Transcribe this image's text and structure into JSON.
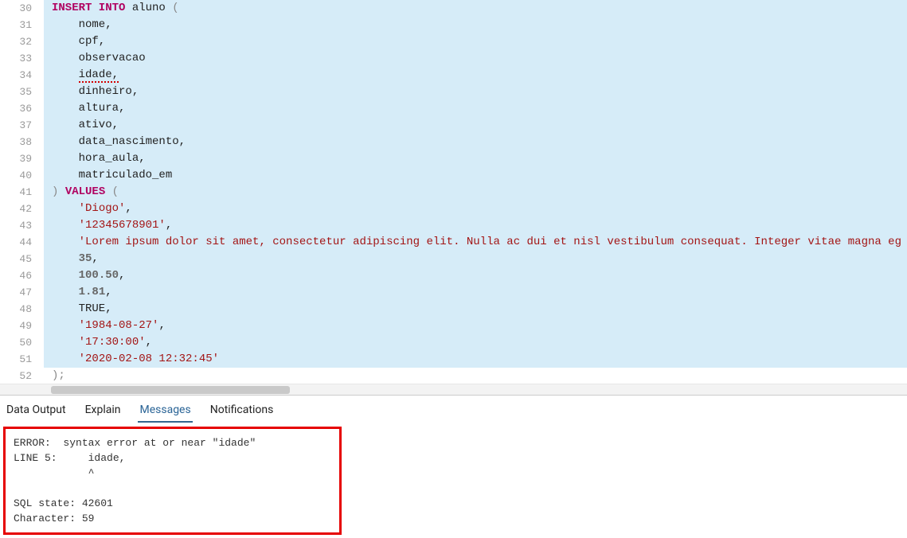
{
  "editor": {
    "lines": [
      {
        "num": 30,
        "sel": true,
        "tokens": [
          {
            "t": "kw",
            "v": "INSERT INTO"
          },
          {
            "t": "txt",
            "v": " aluno "
          },
          {
            "t": "punct",
            "v": "("
          }
        ]
      },
      {
        "num": 31,
        "sel": true,
        "tokens": [
          {
            "t": "txt",
            "v": "    nome,"
          }
        ]
      },
      {
        "num": 32,
        "sel": true,
        "tokens": [
          {
            "t": "txt",
            "v": "    cpf,"
          }
        ]
      },
      {
        "num": 33,
        "sel": true,
        "tokens": [
          {
            "t": "txt",
            "v": "    observacao"
          }
        ]
      },
      {
        "num": 34,
        "sel": true,
        "tokens": [
          {
            "t": "txt",
            "v": "    "
          },
          {
            "t": "err",
            "v": "idade,"
          }
        ]
      },
      {
        "num": 35,
        "sel": true,
        "tokens": [
          {
            "t": "txt",
            "v": "    dinheiro,"
          }
        ]
      },
      {
        "num": 36,
        "sel": true,
        "tokens": [
          {
            "t": "txt",
            "v": "    altura,"
          }
        ]
      },
      {
        "num": 37,
        "sel": true,
        "tokens": [
          {
            "t": "txt",
            "v": "    ativo,"
          }
        ]
      },
      {
        "num": 38,
        "sel": true,
        "tokens": [
          {
            "t": "txt",
            "v": "    data_nascimento,"
          }
        ]
      },
      {
        "num": 39,
        "sel": true,
        "tokens": [
          {
            "t": "txt",
            "v": "    hora_aula,"
          }
        ]
      },
      {
        "num": 40,
        "sel": true,
        "tokens": [
          {
            "t": "txt",
            "v": "    matriculado_em"
          }
        ]
      },
      {
        "num": 41,
        "sel": true,
        "tokens": [
          {
            "t": "punct",
            "v": ")"
          },
          {
            "t": "txt",
            "v": " "
          },
          {
            "t": "kw",
            "v": "VALUES"
          },
          {
            "t": "txt",
            "v": " "
          },
          {
            "t": "punct",
            "v": "("
          }
        ]
      },
      {
        "num": 42,
        "sel": true,
        "tokens": [
          {
            "t": "txt",
            "v": "    "
          },
          {
            "t": "str",
            "v": "'Diogo'"
          },
          {
            "t": "txt",
            "v": ","
          }
        ]
      },
      {
        "num": 43,
        "sel": true,
        "tokens": [
          {
            "t": "txt",
            "v": "    "
          },
          {
            "t": "str",
            "v": "'12345678901'"
          },
          {
            "t": "txt",
            "v": ","
          }
        ]
      },
      {
        "num": 44,
        "sel": true,
        "tokens": [
          {
            "t": "txt",
            "v": "    "
          },
          {
            "t": "str",
            "v": "'Lorem ipsum dolor sit amet, consectetur adipiscing elit. Nulla ac dui et nisl vestibulum consequat. Integer vitae magna eg"
          }
        ]
      },
      {
        "num": 45,
        "sel": true,
        "tokens": [
          {
            "t": "txt",
            "v": "    "
          },
          {
            "t": "num",
            "v": "35"
          },
          {
            "t": "txt",
            "v": ","
          }
        ]
      },
      {
        "num": 46,
        "sel": true,
        "tokens": [
          {
            "t": "txt",
            "v": "    "
          },
          {
            "t": "num",
            "v": "100.50"
          },
          {
            "t": "txt",
            "v": ","
          }
        ]
      },
      {
        "num": 47,
        "sel": true,
        "tokens": [
          {
            "t": "txt",
            "v": "    "
          },
          {
            "t": "num",
            "v": "1.81"
          },
          {
            "t": "txt",
            "v": ","
          }
        ]
      },
      {
        "num": 48,
        "sel": true,
        "tokens": [
          {
            "t": "txt",
            "v": "    TRUE,"
          }
        ]
      },
      {
        "num": 49,
        "sel": true,
        "tokens": [
          {
            "t": "txt",
            "v": "    "
          },
          {
            "t": "str",
            "v": "'1984-08-27'"
          },
          {
            "t": "txt",
            "v": ","
          }
        ]
      },
      {
        "num": 50,
        "sel": true,
        "tokens": [
          {
            "t": "txt",
            "v": "    "
          },
          {
            "t": "str",
            "v": "'17:30:00'"
          },
          {
            "t": "txt",
            "v": ","
          }
        ]
      },
      {
        "num": 51,
        "sel": true,
        "tokens": [
          {
            "t": "txt",
            "v": "    "
          },
          {
            "t": "str",
            "v": "'2020-02-08 12:32:45'"
          }
        ]
      },
      {
        "num": 52,
        "sel": false,
        "tokens": [
          {
            "t": "punct",
            "v": ");"
          }
        ]
      }
    ]
  },
  "tabs": {
    "data_output": "Data Output",
    "explain": "Explain",
    "messages": "Messages",
    "notifications": "Notifications"
  },
  "messages": {
    "line1": "ERROR:  syntax error at or near \"idade\"",
    "line2": "LINE 5:     idade,",
    "line3": "            ^",
    "line4": "SQL state: 42601",
    "line5": "Character: 59"
  }
}
